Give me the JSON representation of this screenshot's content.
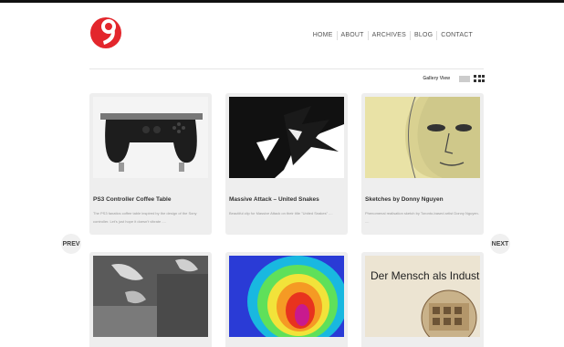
{
  "nav": {
    "items": [
      "HOME",
      "ABOUT",
      "ARCHIVES",
      "BLOG",
      "CONTACT"
    ]
  },
  "toolbar": {
    "gallery_view_label": "Gallery View"
  },
  "pager": {
    "prev": "PREV",
    "next": "NEXT"
  },
  "cards": [
    {
      "title": "PS3 Controller Coffee Table",
      "desc": "The PS3 fanatics coffee table inspired by the design of the Sony controller. Let's just hope it doesn't vibrate ...."
    },
    {
      "title": "Massive Attack – United Snakes",
      "desc": "Beautiful clip for Massive Attack on their title \"United Snakes\" ...."
    },
    {
      "title": "Sketches by Donny Nguyen",
      "desc": "Phenomenal realisation sketch by Toronto-based artist Donny Nguyen. ...."
    },
    {
      "title": "",
      "desc": ""
    },
    {
      "title": "",
      "desc": ""
    },
    {
      "title": "",
      "desc": ""
    }
  ],
  "poster_text": "Der Mensch als Industr",
  "colors": {
    "logo": "#e3262c",
    "accent": "#e3262c"
  }
}
